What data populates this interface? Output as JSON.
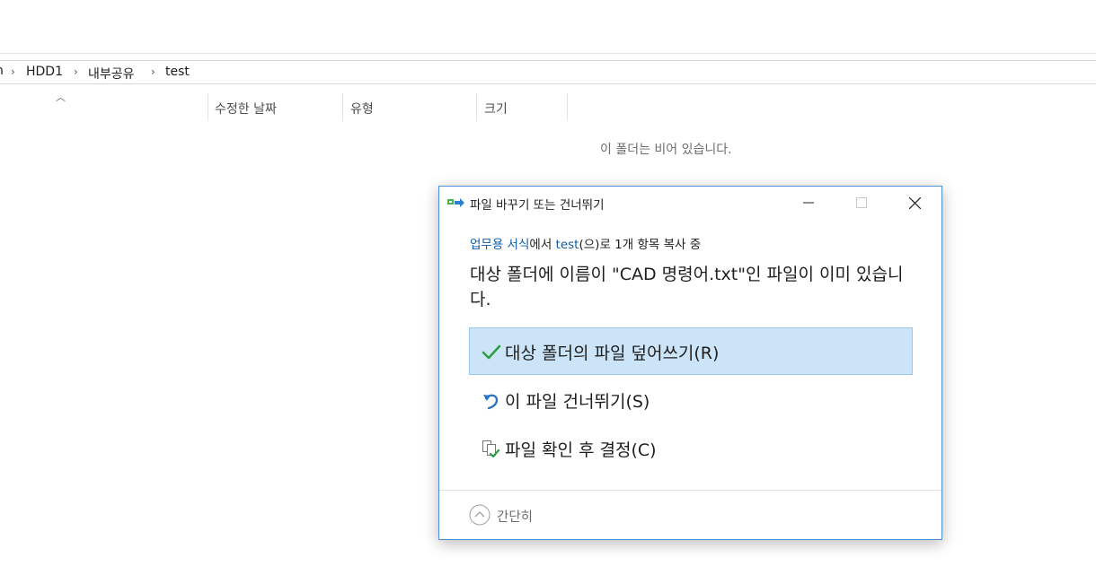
{
  "breadcrumb": {
    "items": [
      "HDD1",
      "내부공유",
      "test"
    ]
  },
  "file_list": {
    "columns": [
      "수정한 날짜",
      "유형",
      "크기"
    ],
    "empty_message": "이 폴더는 비어 있습니다."
  },
  "dialog": {
    "title": "파일 바꾸기 또는 건너뛰기",
    "copy_status": {
      "source": "업무용 서식",
      "text1": "에서 ",
      "destination": "test",
      "text2": "(으)로 1개 항목 복사 중"
    },
    "message": "대상 폴더에 이름이 \"CAD 명령어.txt\"인 파일이 이미 있습니다.",
    "options": [
      {
        "label": "대상 폴더의 파일 덮어쓰기(R)",
        "icon": "checkmark-icon",
        "selected": true
      },
      {
        "label": "이 파일 건너뛰기(S)",
        "icon": "undo-arrow-icon",
        "selected": false
      },
      {
        "label": "파일 확인 후 결정(C)",
        "icon": "compare-files-icon",
        "selected": false
      }
    ],
    "collapse_label": "간단히"
  },
  "colors": {
    "accent_link": "#0b5cad",
    "selected_bg": "#cce4f7",
    "selected_border": "#99c9ef",
    "dialog_border": "#4d8fd6",
    "check_green": "#2e9e44"
  }
}
